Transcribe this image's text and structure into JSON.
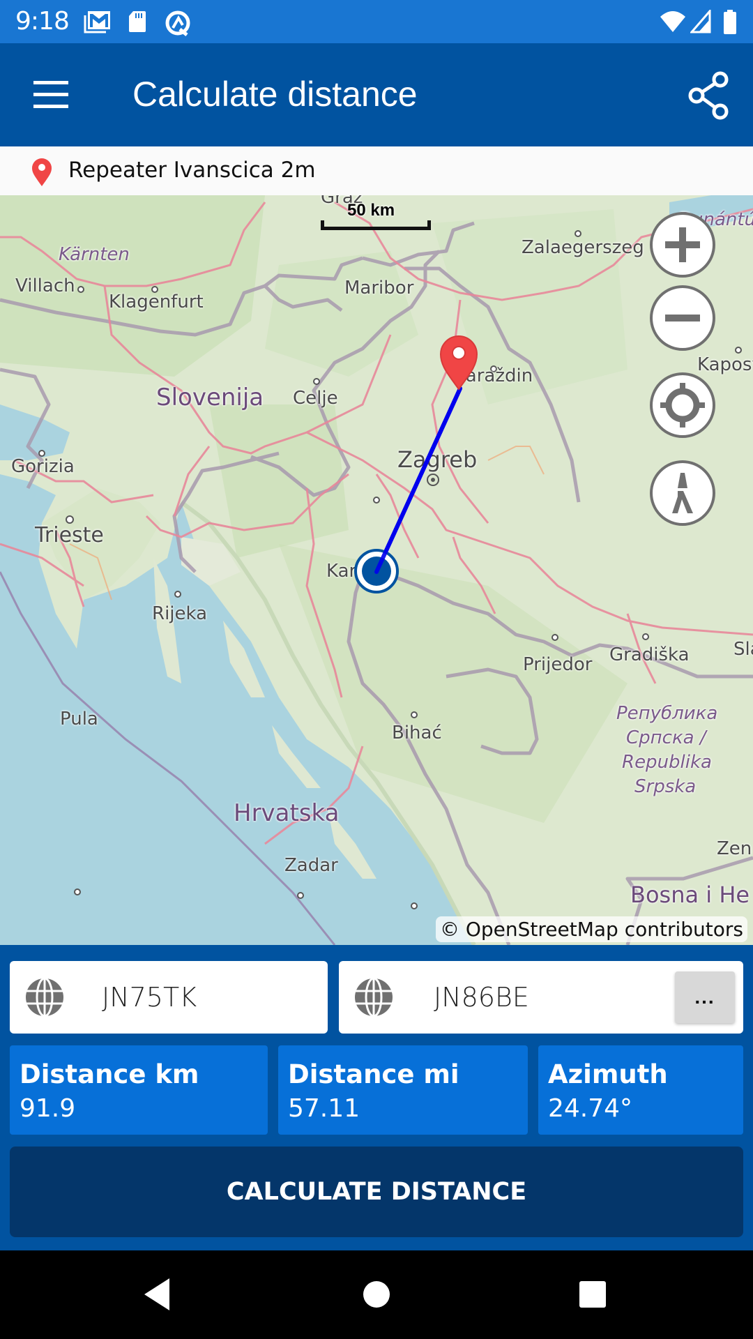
{
  "status_bar": {
    "time": "9:18",
    "left_icons": [
      "gmail-icon",
      "sd-card-icon",
      "sync-icon"
    ],
    "right_icons": [
      "wifi-icon",
      "cell-signal-icon",
      "battery-icon"
    ]
  },
  "app_bar": {
    "title": "Calculate distance",
    "menu_icon": "hamburger-menu-icon",
    "share_icon": "share-icon"
  },
  "location_bar": {
    "icon": "map-pin-icon",
    "label": "Repeater Ivanscica 2m"
  },
  "map": {
    "scale_label": "50 km",
    "attribution": "© OpenStreetMap contributors",
    "controls": [
      "zoom-in",
      "zoom-out",
      "my-location",
      "compass"
    ],
    "labels": {
      "graz": "Graz",
      "karnten": "Kärnten",
      "villach": "Villach",
      "klagenfurt": "Klagenfurt",
      "maribor": "Maribor",
      "zalaegerszeg": "Zalaegerszeg",
      "balaton": "Dunántúl",
      "kaposvar": "Kaposv",
      "varazdin": "Varaždin",
      "slovenija": "Slovenija",
      "celje": "Celje",
      "gorizia": "Gorizia",
      "trieste": "Trieste",
      "zagreb": "Zagreb",
      "karlovac": "Kar",
      "rijeka": "Rijeka",
      "prijedor": "Prijedor",
      "gradiska": "Gradiška",
      "sla": "Sla",
      "pula": "Pula",
      "bihac": "Bihać",
      "rs1": "Република",
      "rs2": "Српска /",
      "rs3": "Republika",
      "rs4": "Srpska",
      "hrvatska": "Hrvatska",
      "zadar": "Zadar",
      "zen": "Zen",
      "bih": "Bosna i He"
    },
    "line_color": "#0000ee",
    "pin_color": "#f04545",
    "origin_color": "#0153a0"
  },
  "panel": {
    "from_locator": "JN75TK",
    "to_locator": "JN86BE",
    "more_button": "...",
    "stats": [
      {
        "label": "Distance km",
        "value": "91.9"
      },
      {
        "label": "Distance mi",
        "value": "57.11"
      },
      {
        "label": "Azimuth",
        "value": "24.74°"
      }
    ],
    "calculate_button": "CALCULATE DISTANCE"
  },
  "nav_bar": {
    "buttons": [
      "back",
      "home",
      "recents"
    ]
  }
}
